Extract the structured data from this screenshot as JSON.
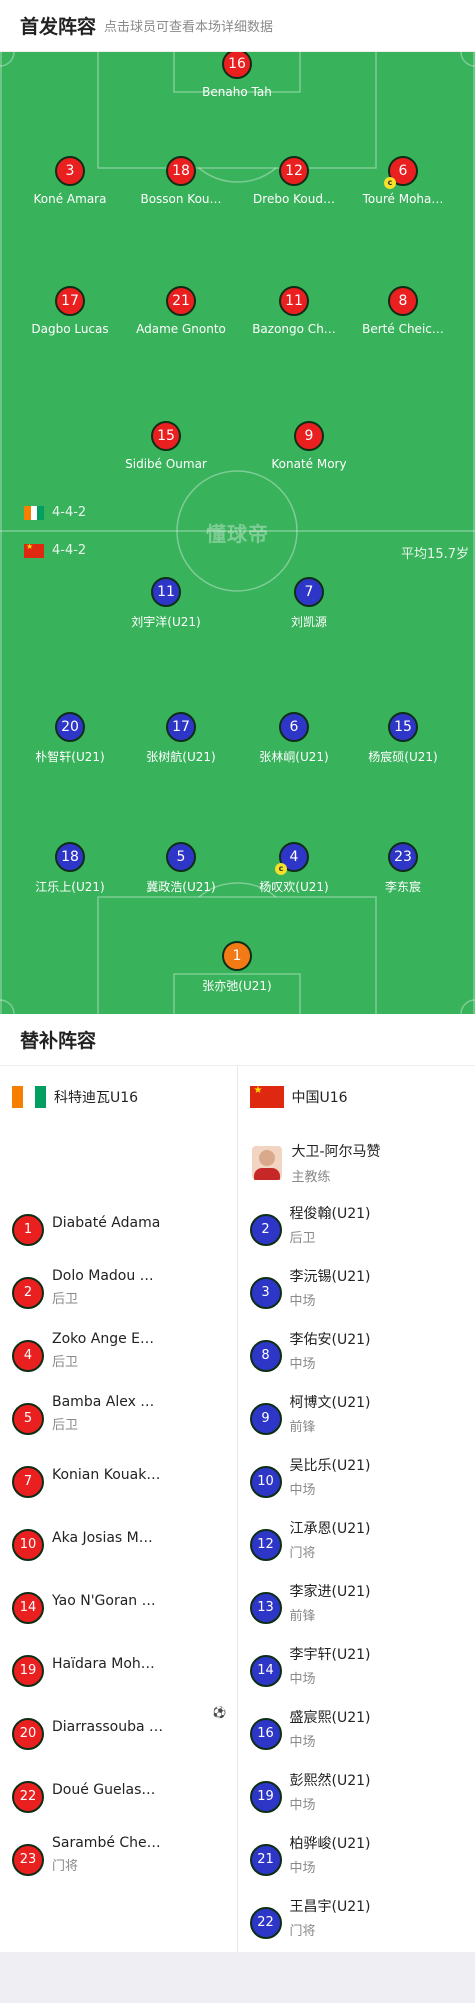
{
  "lineup_header": {
    "title": "首发阵容",
    "subtitle": "点击球员可查看本场详细数据"
  },
  "pitch": {
    "watermark": "懂球帝",
    "home_team": {
      "formation": "4-4-2",
      "flag_colors": [
        "#f77f00",
        "#ffffff",
        "#009e60"
      ],
      "players": [
        {
          "number": "16",
          "name": "Benaho Tah",
          "role": "gk"
        },
        {
          "number": "3",
          "name": "Koné Amara"
        },
        {
          "number": "18",
          "name": "Bosson Kou…"
        },
        {
          "number": "12",
          "name": "Drebo Koud…"
        },
        {
          "number": "6",
          "name": "Touré Moha…",
          "captain": "c"
        },
        {
          "number": "17",
          "name": "Dagbo Lucas"
        },
        {
          "number": "21",
          "name": "Adame Gnonto"
        },
        {
          "number": "11",
          "name": "Bazongo Ch…"
        },
        {
          "number": "8",
          "name": "Berté Cheic…"
        },
        {
          "number": "15",
          "name": "Sidibé Oumar"
        },
        {
          "number": "9",
          "name": "Konaté Mory"
        }
      ]
    },
    "away_team": {
      "formation": "4-4-2",
      "avg_age": "平均15.7岁",
      "players": [
        {
          "number": "11",
          "name": "刘宇洋(U21)"
        },
        {
          "number": "7",
          "name": "刘凯源"
        },
        {
          "number": "20",
          "name": "朴智轩(U21)"
        },
        {
          "number": "17",
          "name": "张树航(U21)"
        },
        {
          "number": "6",
          "name": "张林峒(U21)"
        },
        {
          "number": "15",
          "name": "杨宸硕(U21)"
        },
        {
          "number": "18",
          "name": "江乐上(U21)"
        },
        {
          "number": "5",
          "name": "冀政浩(U21)"
        },
        {
          "number": "4",
          "name": "杨叹欢(U21)",
          "captain": "c"
        },
        {
          "number": "23",
          "name": "李东宸"
        },
        {
          "number": "1",
          "name": "张亦弛(U21)",
          "role": "gk"
        }
      ]
    }
  },
  "subs_header": {
    "title": "替补阵容"
  },
  "subs": {
    "home": {
      "team_name": "科特迪瓦U16",
      "players": [
        {
          "number": "1",
          "name": "Diabaté Adama",
          "position": ""
        },
        {
          "number": "2",
          "name": "Dolo Madou …",
          "position": "后卫"
        },
        {
          "number": "4",
          "name": "Zoko Ange E…",
          "position": "后卫"
        },
        {
          "number": "5",
          "name": "Bamba Alex …",
          "position": "后卫"
        },
        {
          "number": "7",
          "name": "Konian Kouak…",
          "position": ""
        },
        {
          "number": "10",
          "name": "Aka Josias M…",
          "position": ""
        },
        {
          "number": "14",
          "name": "Yao N'Goran …",
          "position": ""
        },
        {
          "number": "19",
          "name": "Haïdara Moh…",
          "position": ""
        },
        {
          "number": "20",
          "name": "Diarrassouba …",
          "position": "",
          "goal_icon": "⚽"
        },
        {
          "number": "22",
          "name": "Doué Guelas…",
          "position": ""
        },
        {
          "number": "23",
          "name": "Sarambé Che…",
          "position": "门将"
        }
      ]
    },
    "away": {
      "team_name": "中国U16",
      "coach": {
        "name": "大卫-阿尔马赞",
        "role": "主教练"
      },
      "players": [
        {
          "number": "2",
          "name": "程俊翰(U21)",
          "position": "后卫"
        },
        {
          "number": "3",
          "name": "李沅锡(U21)",
          "position": "中场"
        },
        {
          "number": "8",
          "name": "李佑安(U21)",
          "position": "中场"
        },
        {
          "number": "9",
          "name": "柯博文(U21)",
          "position": "前锋"
        },
        {
          "number": "10",
          "name": "吴比乐(U21)",
          "position": "中场"
        },
        {
          "number": "12",
          "name": "江承恩(U21)",
          "position": "门将"
        },
        {
          "number": "13",
          "name": "李家进(U21)",
          "position": "前锋"
        },
        {
          "number": "14",
          "name": "李宇轩(U21)",
          "position": "中场"
        },
        {
          "number": "16",
          "name": "盛宸熙(U21)",
          "position": "中场"
        },
        {
          "number": "19",
          "name": "彭熙然(U21)",
          "position": "中场"
        },
        {
          "number": "21",
          "name": "柏骅峻(U21)",
          "position": "中场"
        },
        {
          "number": "22",
          "name": "王昌宇(U21)",
          "position": "门将"
        }
      ]
    }
  }
}
